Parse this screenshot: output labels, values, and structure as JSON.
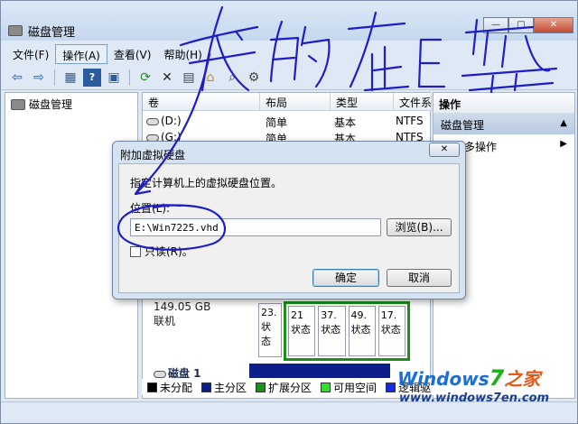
{
  "window": {
    "title": "磁盘管理",
    "buttons": {
      "minimize": "—",
      "maximize": "□",
      "close": "✕"
    }
  },
  "menu": [
    {
      "label": "文件(F)"
    },
    {
      "label": "操作(A)"
    },
    {
      "label": "查看(V)"
    },
    {
      "label": "帮助(H)"
    }
  ],
  "toolbar": {
    "icons": [
      "back-icon",
      "forward-icon",
      "show-hide-tree-icon",
      "help-icon",
      "properties-icon",
      "refresh-icon",
      "delete-icon",
      "new-disk-icon",
      "open-folder-icon",
      "search-icon",
      "settings-icon"
    ]
  },
  "tree": {
    "root": "磁盘管理"
  },
  "volume_table": {
    "headers": [
      "卷",
      "布局",
      "类型",
      "文件系"
    ],
    "rows": [
      {
        "volume": "(D:)",
        "layout": "简单",
        "type": "基本",
        "fs": "NTFS"
      },
      {
        "volume": "(G:)",
        "layout": "简单",
        "type": "基本",
        "fs": "NTFS"
      }
    ]
  },
  "disk0": {
    "size": "149.05 GB",
    "status": "联机",
    "first_partition": {
      "size": "23.",
      "status": "状态"
    },
    "partitions": [
      {
        "size": "21",
        "status": "状态"
      },
      {
        "size": "37.",
        "status": "状态"
      },
      {
        "size": "49.",
        "status": "状态"
      },
      {
        "size": "17.",
        "status": "状态"
      }
    ]
  },
  "disk1": {
    "label": "磁盘 1"
  },
  "actions": {
    "header": "操作",
    "section": "磁盘管理",
    "more": "更多操作"
  },
  "legend": [
    {
      "label": "未分配",
      "color": "#000000"
    },
    {
      "label": "主分区",
      "color": "#0d1e8a"
    },
    {
      "label": "扩展分区",
      "color": "#1c8f1c"
    },
    {
      "label": "可用空间",
      "color": "#33dd33"
    },
    {
      "label": "逻辑驱",
      "color": "#1a2bdd"
    }
  ],
  "dialog": {
    "title": "附加虚拟硬盘",
    "instruction": "指定计算机上的虚拟硬盘位置。",
    "location_label": "位置(L):",
    "location_value": "E:\\Win7225.vhd",
    "browse": "浏览(B)...",
    "readonly": "只读(R)。",
    "ok": "确定",
    "cancel": "取消"
  },
  "annotation": {
    "text": "我的在E盘",
    "color": "#1e1ec8"
  },
  "watermark": {
    "logo_a": "Windows",
    "logo_b": "7",
    "logo_c": "之家",
    "url": "www.windows7en.com"
  }
}
